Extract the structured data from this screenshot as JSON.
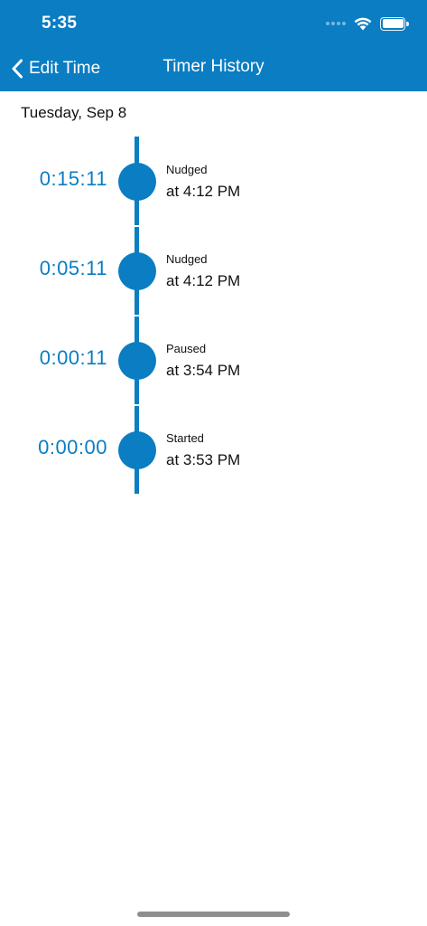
{
  "status_bar": {
    "time": "5:35",
    "icons": [
      "signal-icon",
      "wifi-icon",
      "battery-icon"
    ]
  },
  "nav": {
    "back_label": "Edit Time",
    "title": "Timer History"
  },
  "date_label": "Tuesday, Sep 8",
  "entries": [
    {
      "elapsed": "0:15:11",
      "event": "Nudged",
      "at": "at 4:12 PM"
    },
    {
      "elapsed": "0:05:11",
      "event": "Nudged",
      "at": "at 4:12 PM"
    },
    {
      "elapsed": "0:00:11",
      "event": "Paused",
      "at": "at 3:54 PM"
    },
    {
      "elapsed": "0:00:00",
      "event": "Started",
      "at": "at 3:53 PM"
    }
  ],
  "colors": {
    "accent": "#0a7dc3",
    "text": "#111111",
    "background": "#ffffff"
  }
}
